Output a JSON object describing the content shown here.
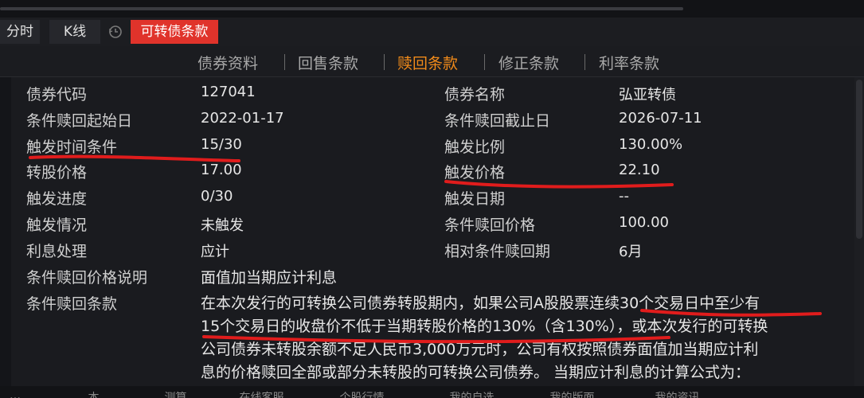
{
  "tabs": {
    "fenshi": "分时",
    "kline": "K线",
    "history_icon": "history-icon",
    "active": "可转债条款"
  },
  "subnav": {
    "items": [
      "债券资料",
      "回售条款",
      "赎回条款",
      "修正条款",
      "利率条款"
    ],
    "selected": "赎回条款"
  },
  "rows": {
    "bond_code": {
      "label": "债券代码",
      "value": "127041"
    },
    "bond_name": {
      "label": "债券名称",
      "value": "弘亚转债"
    },
    "call_start": {
      "label": "条件赎回起始日",
      "value": "2022-01-17"
    },
    "call_end": {
      "label": "条件赎回截止日",
      "value": "2026-07-11"
    },
    "trigger_time": {
      "label": "触发时间条件",
      "value": "15/30"
    },
    "trigger_ratio": {
      "label": "触发比例",
      "value": "130.00%"
    },
    "conv_price": {
      "label": "转股价格",
      "value": "17.00"
    },
    "trigger_price": {
      "label": "触发价格",
      "value": "22.10"
    },
    "trigger_progress": {
      "label": "触发进度",
      "value": "0/30"
    },
    "trigger_date": {
      "label": "触发日期",
      "value": "--"
    },
    "trigger_status": {
      "label": "触发情况",
      "value": "未触发"
    },
    "call_price": {
      "label": "条件赎回价格",
      "value": "100.00"
    },
    "interest": {
      "label": "利息处理",
      "value": "应计"
    },
    "relative_period": {
      "label": "相对条件赎回期",
      "value": "6月"
    },
    "call_price_note": {
      "label": "条件赎回价格说明",
      "value": "面值加当期应计利息"
    },
    "call_clause": {
      "label": "条件赎回条款"
    }
  },
  "clause_lines": [
    "在本次发行的可转换公司债券转股期内，如果公司A股股票连续30个交易日中至少有",
    "15个交易日的收盘价不低于当期转股价格的130%（含130%），或本次发行的可转换",
    "公司债券未转股余额不足人民币3,000万元时，公司有权按照债券面值加当期应计利",
    "息的价格赎回全部或部分未转股的可转换公司债券。 当期应计利息的计算公式为："
  ],
  "bottom_bar": [
    "…",
    "… 本…",
    "… 测算",
    "… 在线客服",
    "… 个股行情",
    "… 我的自选",
    "… 我的版面",
    "… 我的资讯"
  ],
  "colors": {
    "accent": "#e0332b",
    "selected_sub": "#f08a1a",
    "annotation": "#e01c1c"
  }
}
